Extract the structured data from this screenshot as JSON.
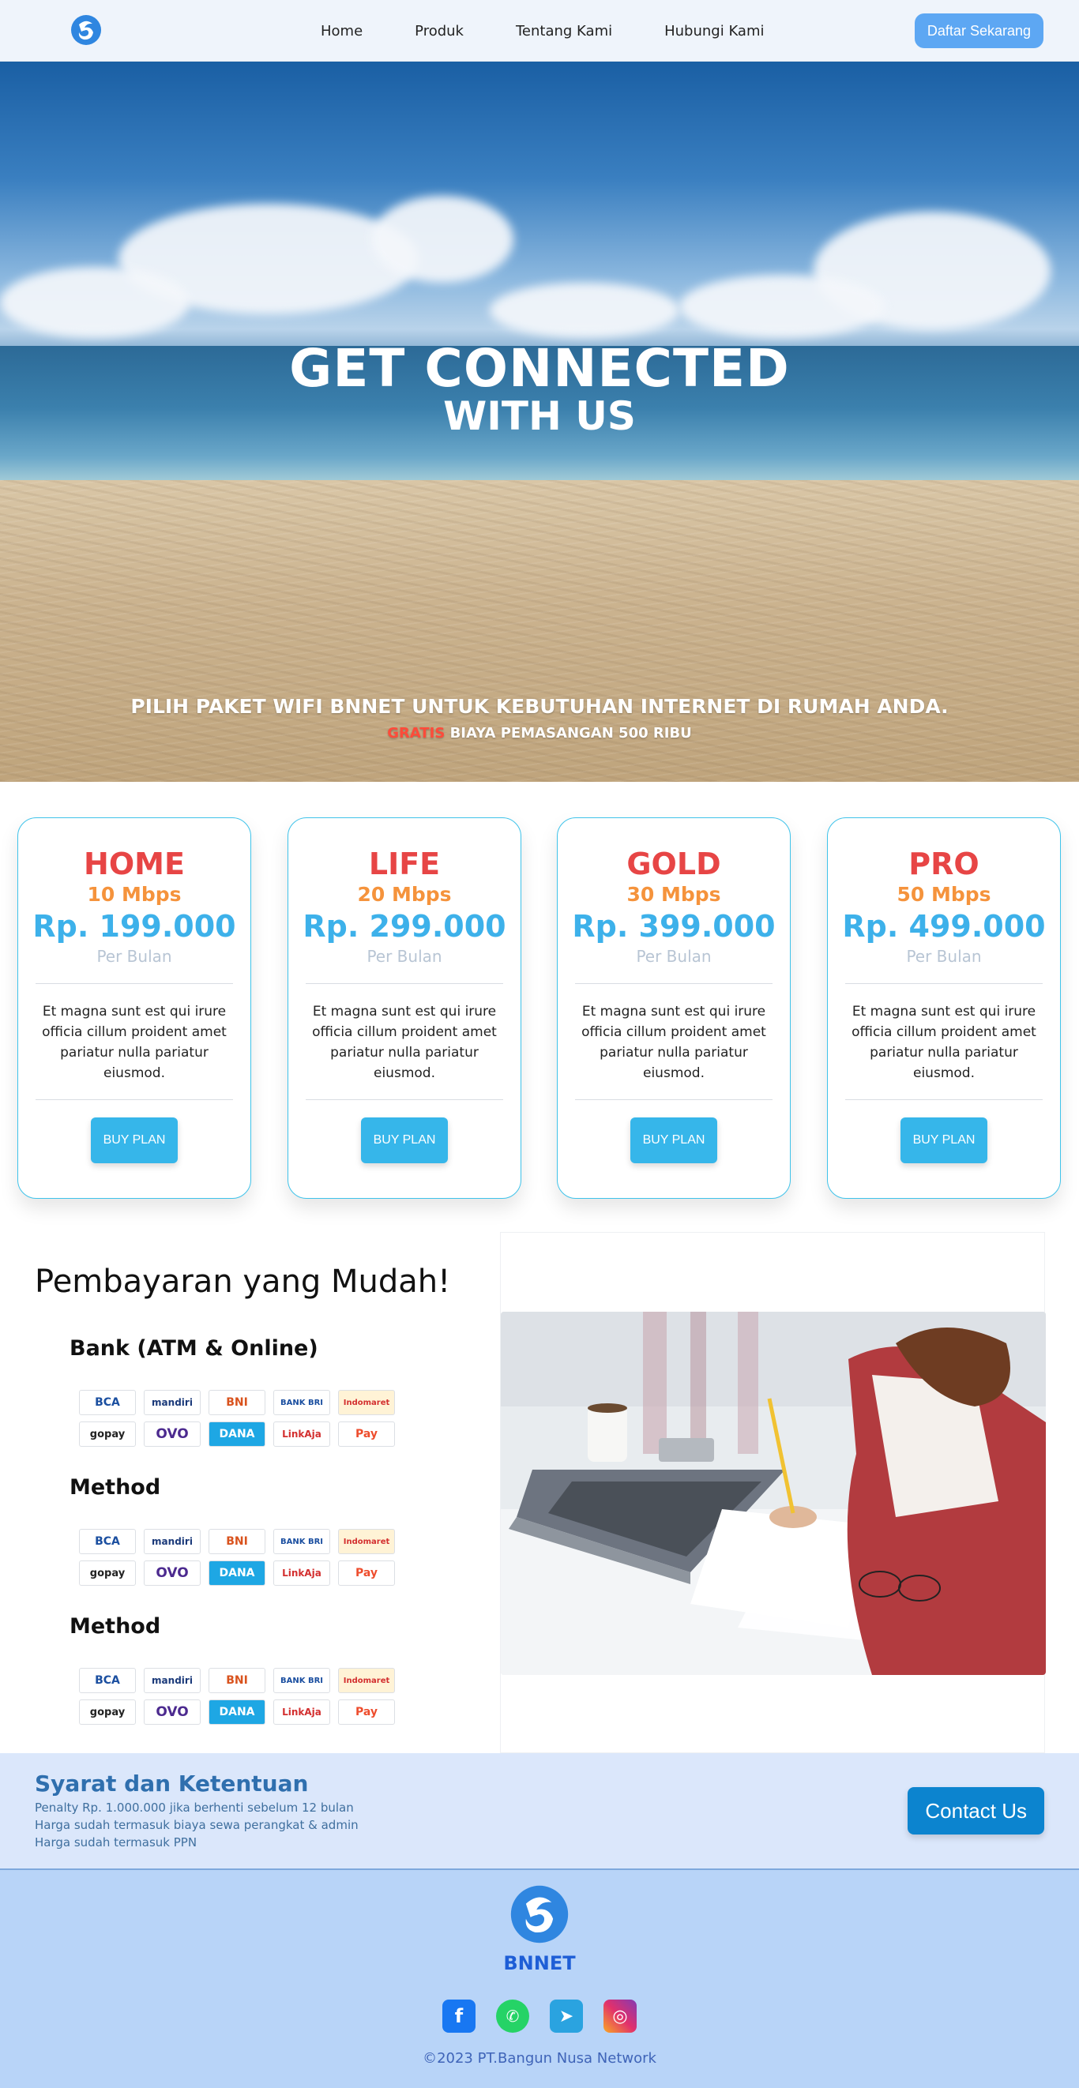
{
  "nav": {
    "links": [
      "Home",
      "Produk",
      "Tentang Kami",
      "Hubungi Kami"
    ],
    "cta": "Daftar Sekarang"
  },
  "hero": {
    "title": "GET CONNECTED",
    "subtitle": "WITH US",
    "tagline": "PILIH PAKET WIFI BNNET UNTUK KEBUTUHAN INTERNET DI RUMAH ANDA.",
    "promo_highlight": "GRATIS",
    "promo_rest": " BIAYA PEMASANGAN 500 RIBU"
  },
  "plans": [
    {
      "name": "HOME",
      "speed": "10 Mbps",
      "price": "Rp. 199.000",
      "period": "Per Bulan",
      "desc": "Et magna sunt est qui irure officia cillum proident amet pariatur nulla pariatur eiusmod.",
      "button": "BUY PLAN"
    },
    {
      "name": "LIFE",
      "speed": "20 Mbps",
      "price": "Rp. 299.000",
      "period": "Per Bulan",
      "desc": "Et magna sunt est qui irure officia cillum proident amet pariatur nulla pariatur eiusmod.",
      "button": "BUY PLAN"
    },
    {
      "name": "GOLD",
      "speed": "30 Mbps",
      "price": "Rp. 399.000",
      "period": "Per Bulan",
      "desc": "Et magna sunt est qui irure officia cillum proident amet pariatur nulla pariatur eiusmod.",
      "button": "BUY PLAN"
    },
    {
      "name": "PRO",
      "speed": "50 Mbps",
      "price": "Rp. 499.000",
      "period": "Per Bulan",
      "desc": "Et magna sunt est qui irure officia cillum proident amet pariatur nulla pariatur eiusmod.",
      "button": "BUY PLAN"
    }
  ],
  "payment": {
    "title": "Pembayaran yang Mudah!",
    "groups": [
      "Bank (ATM & Online)",
      "Method",
      "Method"
    ],
    "logos": [
      "BCA",
      "mandiri",
      "BNI",
      "BANK BRI",
      "Indomaret",
      "gopay",
      "OVO",
      "DANA",
      "LinkAja",
      "Pay"
    ]
  },
  "terms": {
    "title": "Syarat dan Ketentuan",
    "lines": [
      "Penalty Rp. 1.000.000 jika berhenti sebelum 12 bulan",
      "Harga sudah termasuk biaya sewa perangkat & admin",
      "Harga sudah termasuk PPN"
    ],
    "contact_button": "Contact Us"
  },
  "footer": {
    "brand": "BNNET",
    "copyright": "©2023 PT.Bangun Nusa Network",
    "socials": [
      "facebook-icon",
      "whatsapp-icon",
      "telegram-icon",
      "instagram-icon"
    ]
  },
  "colors": {
    "accent": "#36b6ea",
    "plan_name": "#e74545",
    "plan_speed": "#f5933c",
    "nav_cta": "#5da7f3",
    "contact": "#0c84cf"
  }
}
